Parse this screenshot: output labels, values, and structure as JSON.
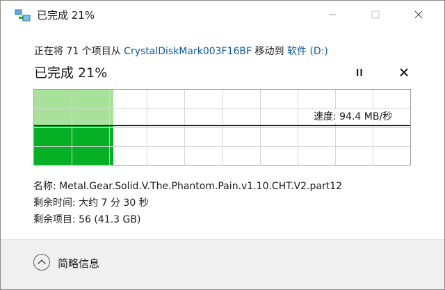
{
  "window": {
    "title": "已完成 21%",
    "icon": "file-copy-icon"
  },
  "transfer": {
    "prefix": "正在将 71 个项目从 ",
    "source": "CrystalDiskMark003F16BF",
    "middle": " 移动到 ",
    "destination": "软件 (D:)",
    "status": "已完成 21%",
    "progress_fraction": 0.21,
    "speed_label": "速度: 94.4 MB/秒"
  },
  "controls": {
    "pause_icon": "pause-icon",
    "cancel_icon": "close-icon",
    "window_buttons": [
      "minimize-icon",
      "maximize-icon",
      "close-icon"
    ]
  },
  "details": {
    "name": "名称: Metal.Gear.Solid.V.The.Phantom.Pain.v1.10.CHT.V2.part12",
    "time_remaining": "剩余时间: 大约 7 分 30 秒",
    "items_remaining": "剩余项目: 56 (41.3 GB)"
  },
  "footer": {
    "toggle_label": "简略信息",
    "toggle_icon": "chevron-up-icon"
  },
  "colors": {
    "progress_light": "#a8e29a",
    "progress_dark": "#06b025",
    "link": "#0b5aa6",
    "footer_bg": "#f0f0f0"
  }
}
